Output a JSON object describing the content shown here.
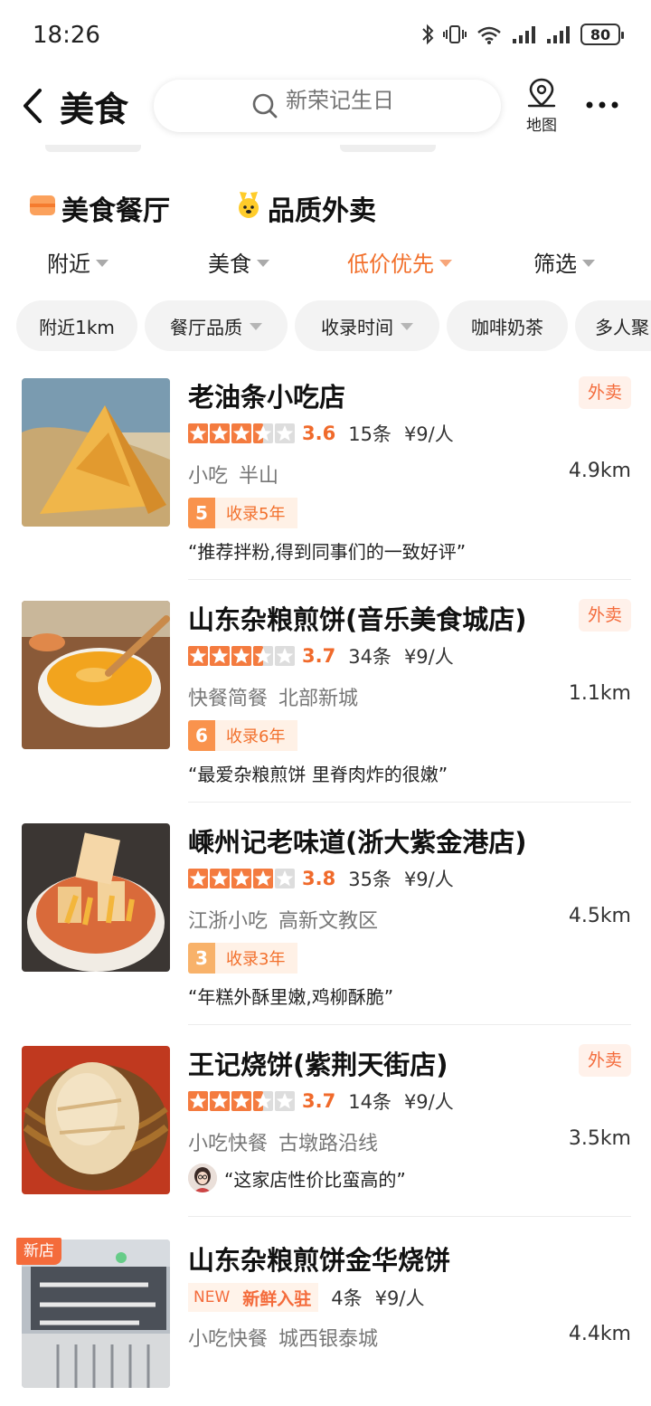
{
  "status": {
    "time": "18:26",
    "battery": "80"
  },
  "nav": {
    "title": "美食",
    "search_placeholder": "新荣记生日",
    "map_label": "地图"
  },
  "section_tabs": [
    {
      "label": "美食餐厅",
      "icon": "restaurant-icon"
    },
    {
      "label": "品质外卖",
      "icon": "delivery-mascot-icon"
    }
  ],
  "filters": [
    {
      "label": "附近"
    },
    {
      "label": "美食"
    },
    {
      "label": "低价优先",
      "active": true
    },
    {
      "label": "筛选"
    }
  ],
  "chips": [
    {
      "label": "附近1km"
    },
    {
      "label": "餐厅品质"
    },
    {
      "label": "收录时间"
    },
    {
      "label": "咖啡奶茶"
    },
    {
      "label": "多人聚"
    }
  ],
  "restaurants": [
    {
      "name": "老油条小吃店",
      "delivery": "外卖",
      "rating": 3.6,
      "score": "3.6",
      "reviews": "15条",
      "price": "¥9/人",
      "category": "小吃",
      "area": "半山",
      "distance": "4.9km",
      "years_num": "5",
      "years_label": "收录5年",
      "quote": "“推荐拌粉,得到同事们的一致好评”"
    },
    {
      "name": "山东杂粮煎饼(音乐美食城店)",
      "delivery": "外卖",
      "rating": 3.7,
      "score": "3.7",
      "reviews": "34条",
      "price": "¥9/人",
      "category": "快餐简餐",
      "area": "北部新城",
      "distance": "1.1km",
      "years_num": "6",
      "years_label": "收录6年",
      "quote": "“最爱杂粮煎饼 里脊肉炸的很嫩”"
    },
    {
      "name": "嵊州记老味道(浙大紫金港店)",
      "rating": 3.8,
      "score": "3.8",
      "reviews": "35条",
      "price": "¥9/人",
      "category": "江浙小吃",
      "area": "高新文教区",
      "distance": "4.5km",
      "years_num": "3",
      "years_label": "收录3年",
      "quote": "“年糕外酥里嫩,鸡柳酥脆”"
    },
    {
      "name": "王记烧饼(紫荆天街店)",
      "delivery": "外卖",
      "rating": 3.7,
      "score": "3.7",
      "reviews": "14条",
      "price": "¥9/人",
      "category": "小吃快餐",
      "area": "古墩路沿线",
      "distance": "3.5km",
      "quote": "“这家店性价比蛮高的”"
    },
    {
      "name": "山东杂粮煎饼金华烧饼",
      "new_tag": "新店",
      "new_badge_a": "NEW",
      "new_badge_b": "新鲜入驻",
      "reviews": "4条",
      "price": "¥9/人",
      "category": "小吃快餐",
      "area": "城西银泰城",
      "distance": "4.4km"
    }
  ],
  "colors": {
    "accent": "#f2702c",
    "star_on": "#f47b3f",
    "star_off": "#dddddd"
  }
}
